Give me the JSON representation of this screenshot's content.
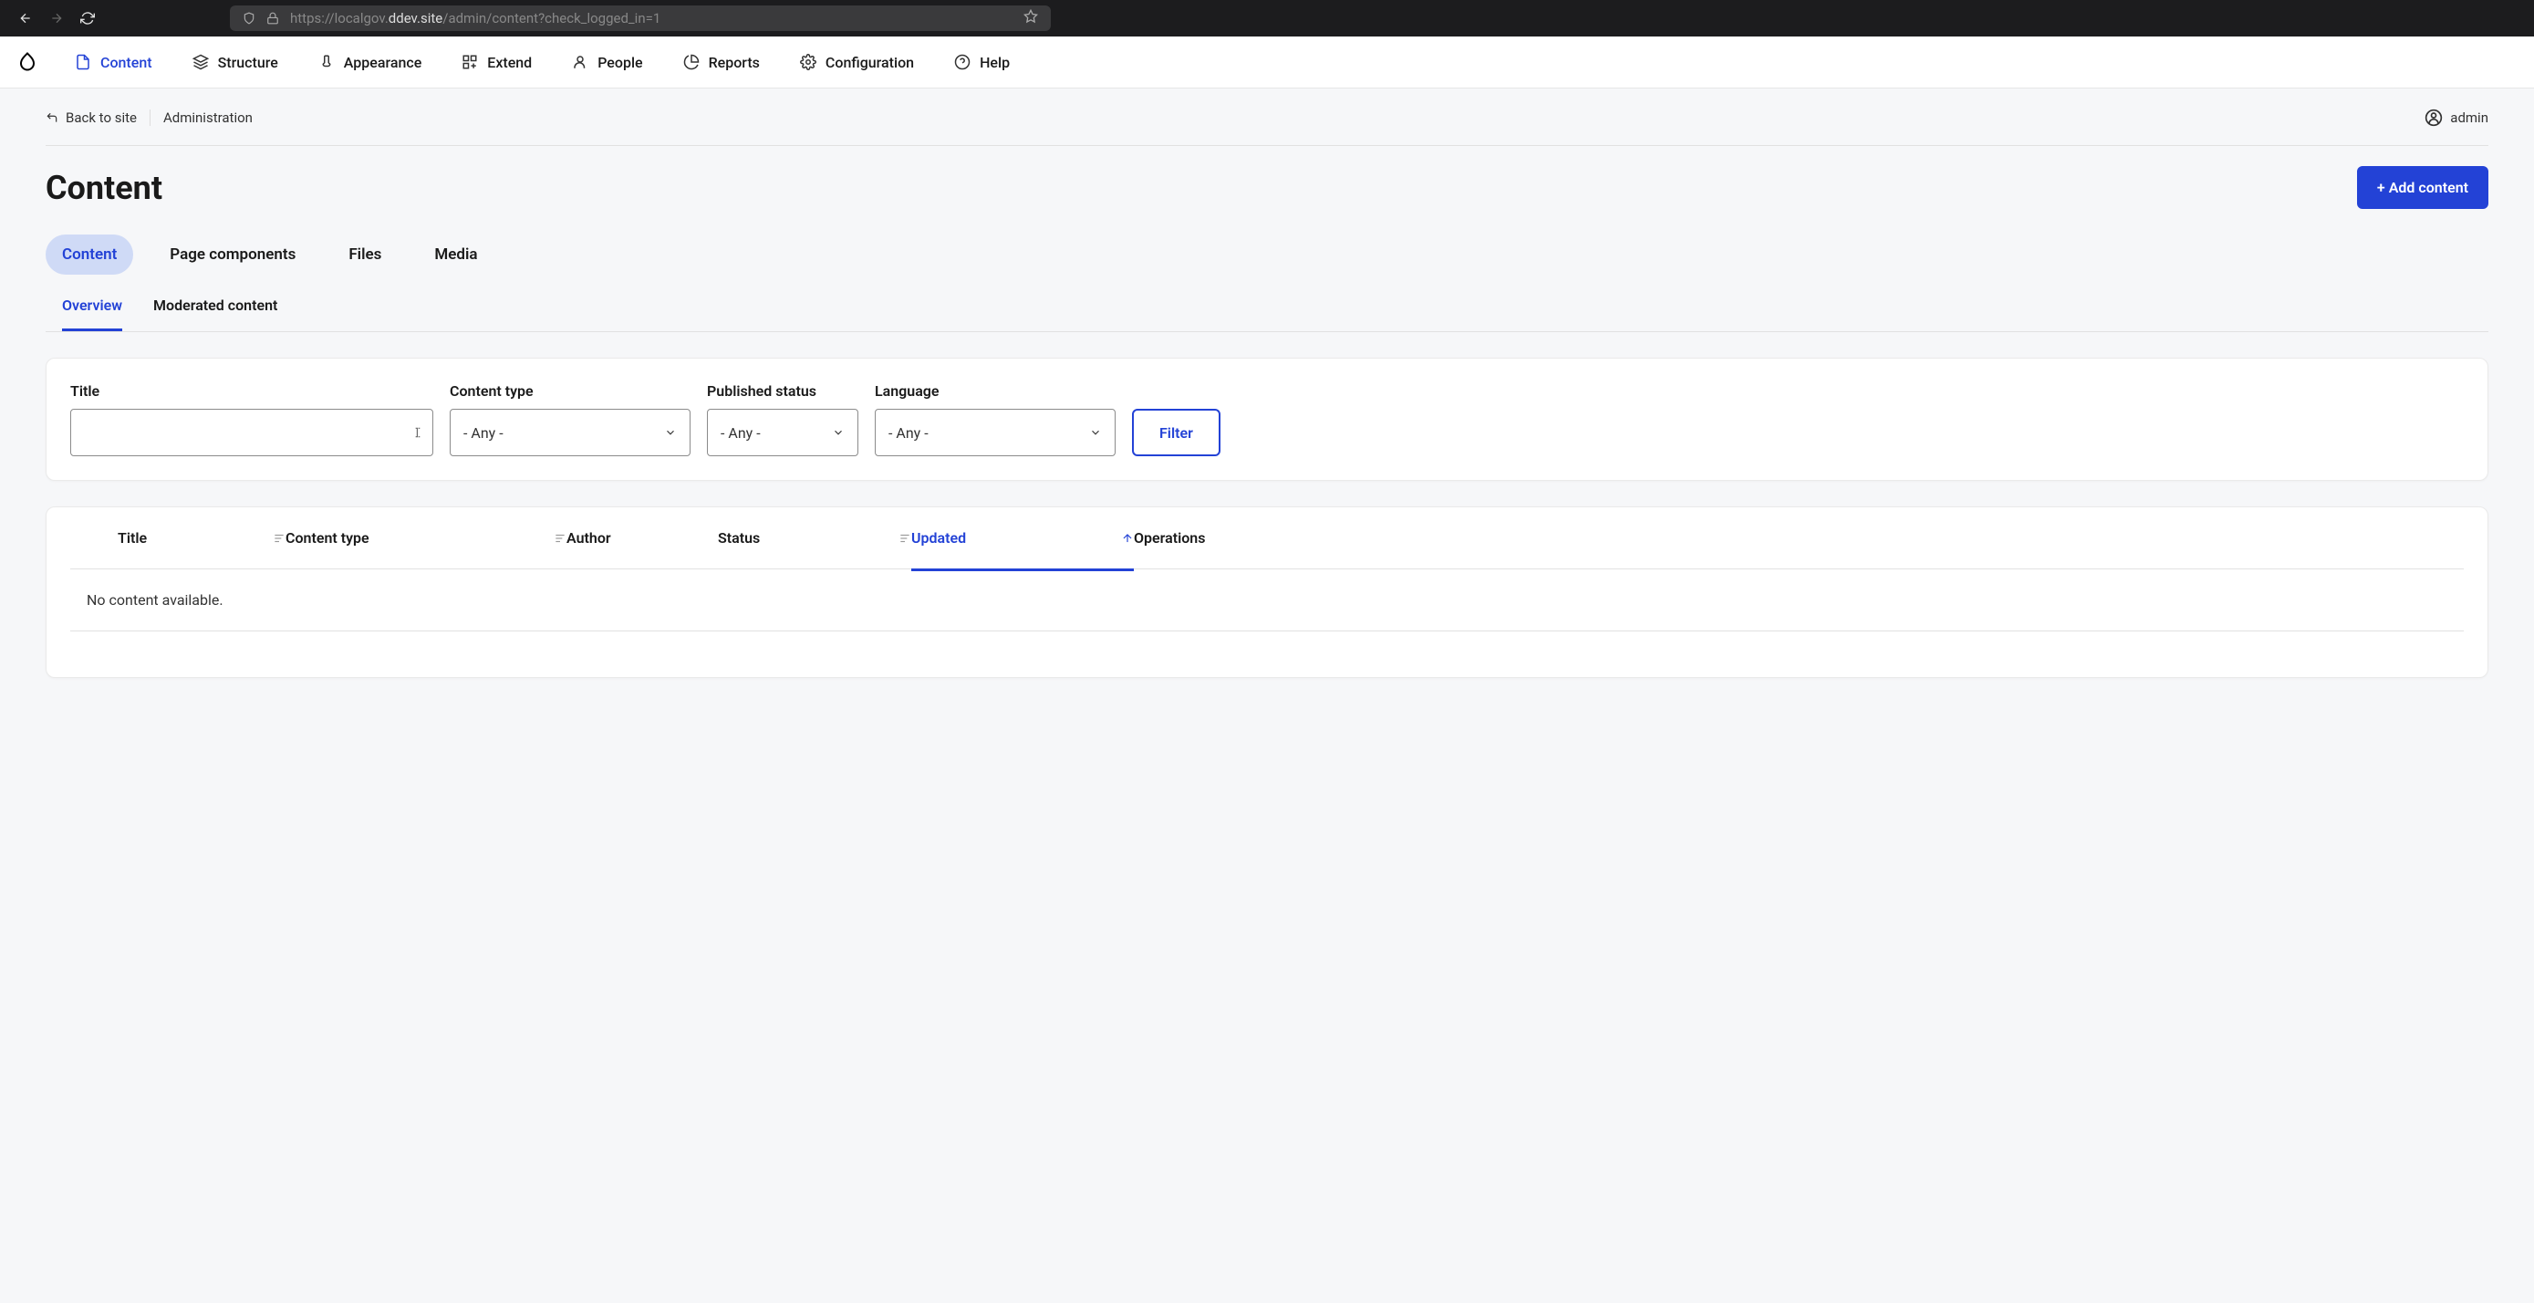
{
  "browser": {
    "url_prefix": "https://localgov.",
    "url_host": "ddev.site",
    "url_path": "/admin/content?check_logged_in=1"
  },
  "admin_nav": {
    "content": "Content",
    "structure": "Structure",
    "appearance": "Appearance",
    "extend": "Extend",
    "people": "People",
    "reports": "Reports",
    "configuration": "Configuration",
    "help": "Help"
  },
  "breadcrumb": {
    "back": "Back to site",
    "admin": "Administration"
  },
  "user": {
    "name": "admin"
  },
  "page": {
    "title": "Content",
    "add_button": "+ Add content"
  },
  "primary_tabs": {
    "content": "Content",
    "page_components": "Page components",
    "files": "Files",
    "media": "Media"
  },
  "secondary_tabs": {
    "overview": "Overview",
    "moderated": "Moderated content"
  },
  "filters": {
    "title_label": "Title",
    "title_value": "",
    "content_type_label": "Content type",
    "content_type_value": "- Any -",
    "published_label": "Published status",
    "published_value": "- Any -",
    "language_label": "Language",
    "language_value": "- Any -",
    "button": "Filter"
  },
  "table": {
    "headers": {
      "title": "Title",
      "content_type": "Content type",
      "author": "Author",
      "status": "Status",
      "updated": "Updated",
      "operations": "Operations"
    },
    "empty": "No content available."
  }
}
